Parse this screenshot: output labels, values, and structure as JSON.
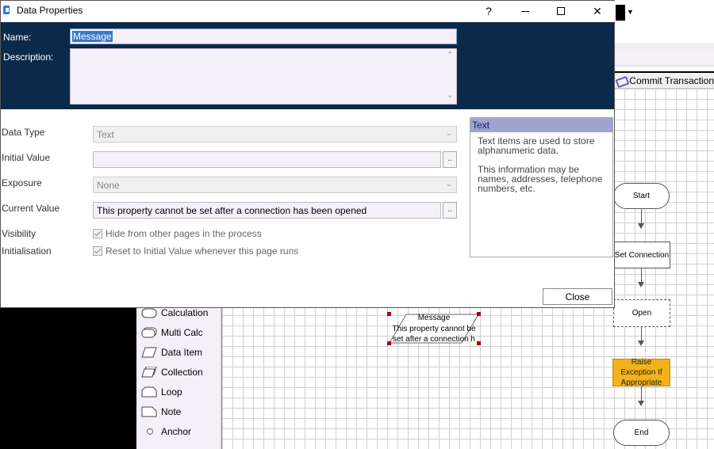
{
  "dialog": {
    "title": "Data Properties",
    "help_label": "?",
    "name_label": "Name:",
    "name_value": "Message",
    "description_label": "Description:",
    "description_value": "",
    "data_type_label": "Data Type",
    "data_type_value": "Text",
    "initial_value_label": "Initial Value",
    "initial_value": "",
    "ellipsis_label": "..",
    "exposure_label": "Exposure",
    "exposure_value": "None",
    "current_value_label": "Current Value",
    "current_value": "This property cannot be set after a connection has been opened",
    "visibility_label": "Visibility",
    "visibility_check": "Hide from other pages in the process",
    "initialisation_label": "Initialisation",
    "initialisation_check": "Reset to Initial Value whenever this page runs",
    "info_title": "Text",
    "info_p1": "Text items are used to store alphanumeric data.",
    "info_p2": "This information may be names, addresses, telephone numbers, etc.",
    "close_label": "Close"
  },
  "toolbar": {
    "commit_label": "Commit Transaction"
  },
  "toolbox": {
    "items": [
      {
        "label": "Calculation",
        "icon": "calculation-icon"
      },
      {
        "label": "Multi Calc",
        "icon": "multi-calc-icon"
      },
      {
        "label": "Data Item",
        "icon": "data-item-icon"
      },
      {
        "label": "Collection",
        "icon": "collection-icon"
      },
      {
        "label": "Loop",
        "icon": "loop-icon"
      },
      {
        "label": "Note",
        "icon": "note-icon"
      },
      {
        "label": "Anchor",
        "icon": "anchor-icon"
      }
    ]
  },
  "canvas": {
    "data_item": {
      "title": "Message",
      "value": "This property cannot be set after a connection h"
    },
    "flow": {
      "start": "Start",
      "set_connection": "Set Connection",
      "open": "Open",
      "raise_exception": "Raise Exception If Appropriate",
      "end": "End"
    }
  },
  "colors": {
    "header_panel": "#0b2a4a",
    "exception_stage": "#f3b21a",
    "info_header": "#9ea3d0"
  }
}
